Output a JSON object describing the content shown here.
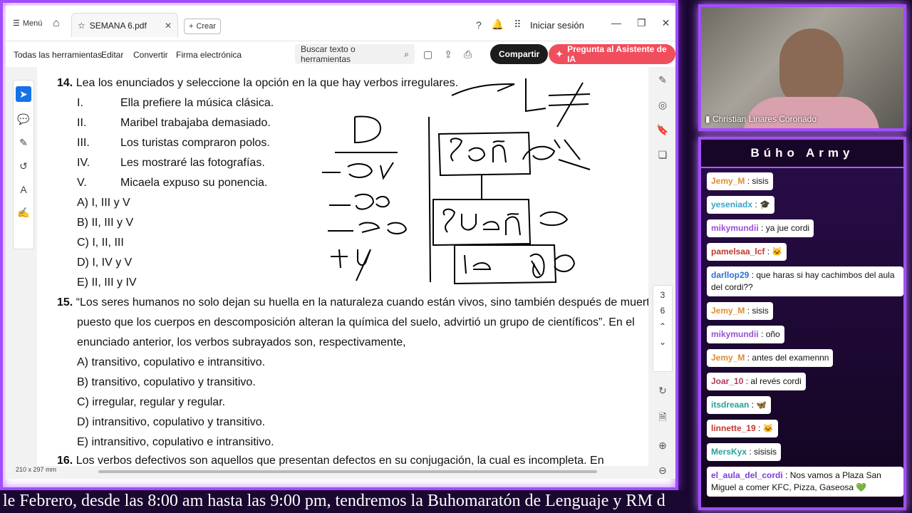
{
  "tabbar": {
    "menu_label": "Menú",
    "tab_title": "SEMANA 6.pdf",
    "new_label": "Crear",
    "signin_label": "Iniciar sesión"
  },
  "toolbar": {
    "all_tools": "Todas las herramientas",
    "edit": "Editar",
    "convert": "Convertir",
    "esign": "Firma electrónica",
    "search_placeholder": "Buscar texto o herramientas",
    "share": "Compartir",
    "ai_assistant": "Pregunta al Asistente de IA"
  },
  "document": {
    "q14": {
      "number": "14.",
      "text": "Lea los enunciados y seleccione la opción en la que hay verbos irregulares.",
      "items": [
        {
          "roman": "I.",
          "text": "Ella prefiere la música clásica."
        },
        {
          "roman": "II.",
          "text": "Maribel trabajaba demasiado."
        },
        {
          "roman": "III.",
          "text": "Los turistas compraron polos."
        },
        {
          "roman": "IV.",
          "text": "Les mostraré las fotografías."
        },
        {
          "roman": "V.",
          "text": "Micaela expuso su ponencia."
        }
      ],
      "options": [
        "A) I, III y V",
        "B) II, III y V",
        "C) I, II, III",
        "D) I, IV y V",
        "E) II, III y IV"
      ]
    },
    "q15": {
      "number": "15.",
      "lines": [
        "“Los seres humanos no solo dejan su huella en la naturaleza cuando están vivos, sino también después de muertos,",
        "puesto que los cuerpos en descomposición alteran la química del suelo, advirtió un grupo de científicos”. En el",
        "enunciado anterior, los verbos subrayados son, respectivamente,"
      ],
      "options": [
        "A) transitivo, copulativo e intransitivo.",
        "B) transitivo, copulativo y transitivo.",
        "C) irregular, regular y regular.",
        "D) intransitivo, copulativo y transitivo.",
        "E) intransitivo, copulativo e intransitivo."
      ]
    },
    "q16": {
      "number": "16.",
      "text": "Los verbos defectivos son aquellos que presentan defectos en su conjugación, la cual es incompleta. En"
    },
    "page_size": "210 x 297 mm",
    "current_page": "3",
    "total_pages": "6"
  },
  "camera": {
    "participant_name": "Christian Linares Coronado"
  },
  "chat": {
    "title": "Búho Army",
    "messages": [
      {
        "user": "Jemy_M",
        "text": "sisis",
        "color": "#e08a2e"
      },
      {
        "user": "yeseniadx",
        "text": "🎓",
        "color": "#3aa3c4"
      },
      {
        "user": "mikymundii",
        "text": "ya jue cordi",
        "color": "#9a4fd6"
      },
      {
        "user": "pamelsaa_lcf",
        "text": "🐱",
        "color": "#c0392b"
      },
      {
        "user": "darllop29",
        "text": "que haras si hay cachimbos del aula del cordi??",
        "color": "#2e6fd6"
      },
      {
        "user": "Jemy_M",
        "text": "sisis",
        "color": "#e08a2e"
      },
      {
        "user": "mikymundii",
        "text": "oño",
        "color": "#9a4fd6"
      },
      {
        "user": "Jemy_M",
        "text": "antes del examennn",
        "color": "#e08a2e"
      },
      {
        "user": "Joar_10",
        "text": "al revés cordi",
        "color": "#b03a5a"
      },
      {
        "user": "itsdreaan",
        "text": "🦋",
        "color": "#2aa198"
      },
      {
        "user": "linnette_19",
        "text": "🐱",
        "color": "#c0392b"
      },
      {
        "user": "MersKyx",
        "text": "sisisis",
        "color": "#2aa198"
      },
      {
        "user": "el_aula_del_cordi",
        "text": "Nos vamos a Plaza San Miguel a comer KFC, Pizza, Gaseosa 💚",
        "color": "#7a3fd6"
      }
    ]
  },
  "ticker": {
    "text": "le Febrero, desde las 8:00 am hasta las 9:00 pm, tendremos la Buhomaratón de Lenguaje y RM d"
  }
}
